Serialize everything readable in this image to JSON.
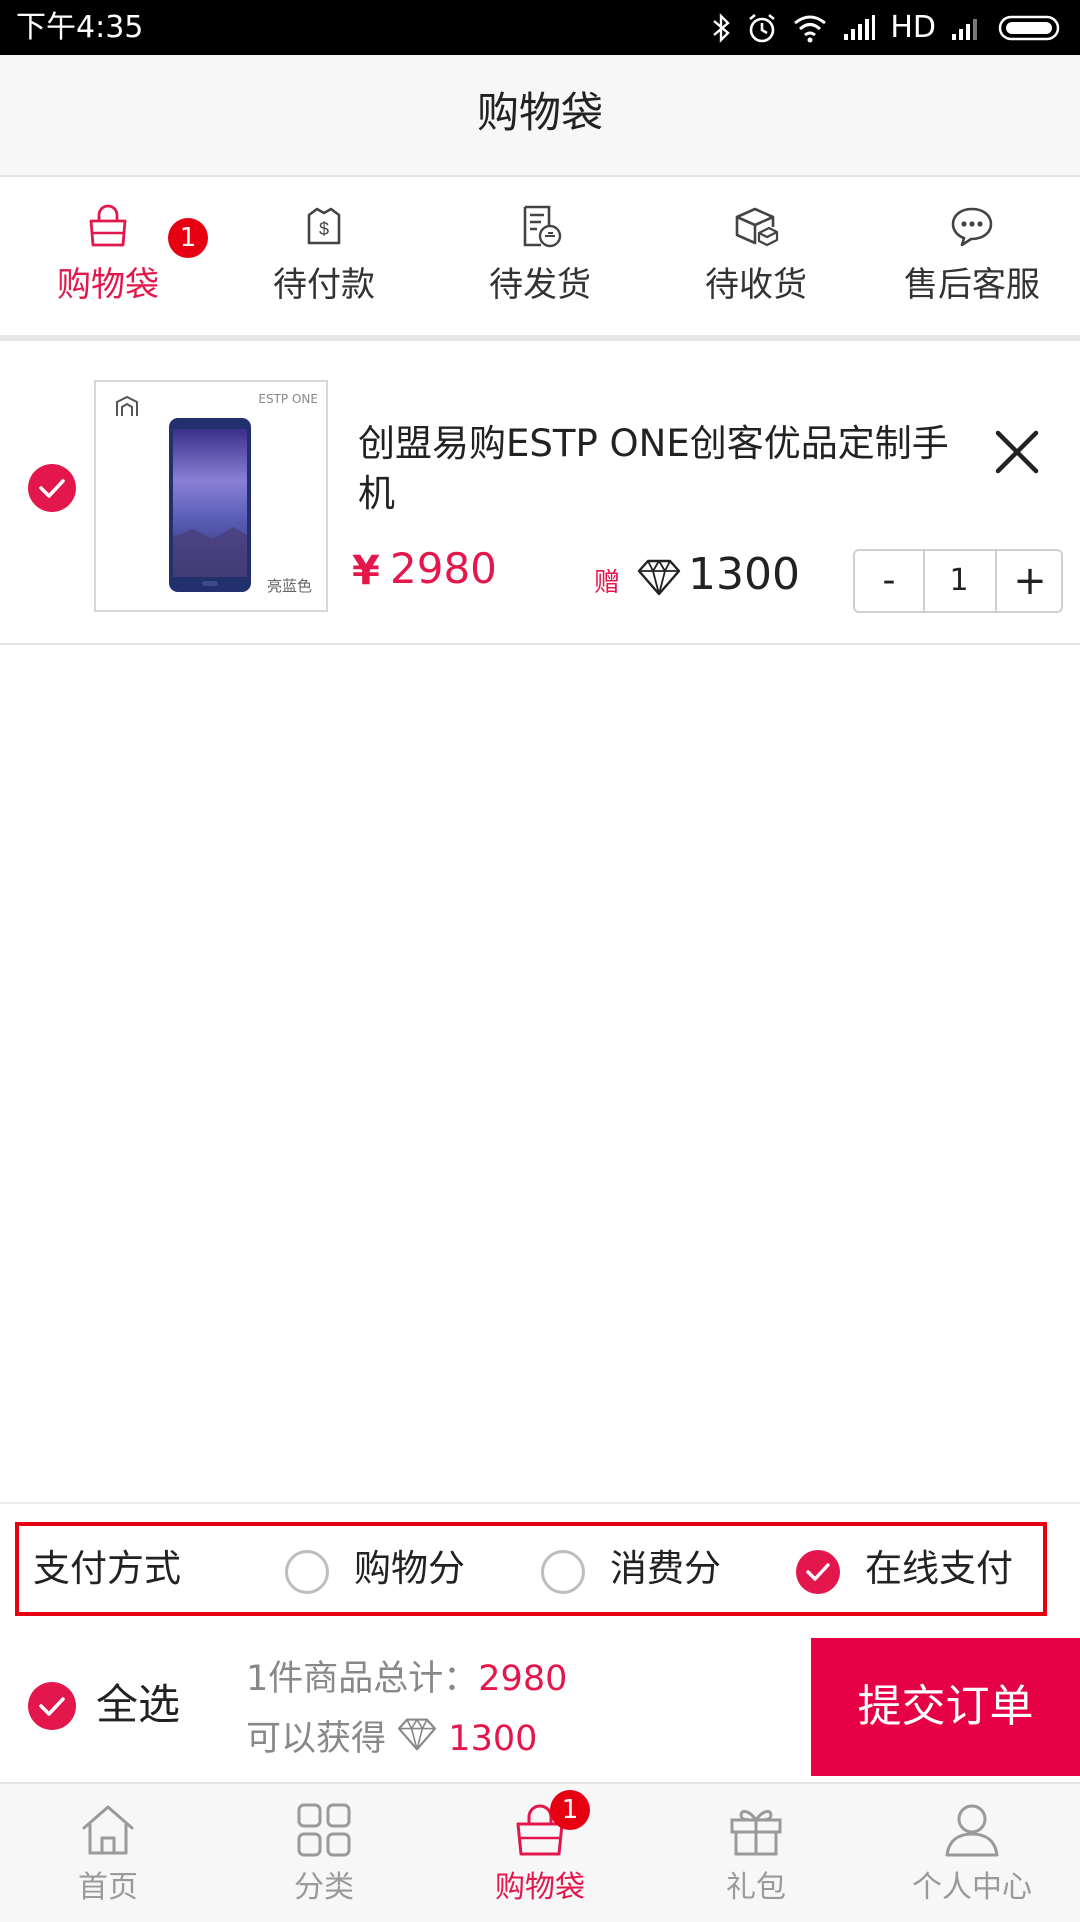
{
  "status_bar": {
    "time": "下午4:35",
    "network": "HD"
  },
  "header": {
    "title": "购物袋"
  },
  "order_tabs": [
    {
      "label": "购物袋",
      "icon": "shopping-bag-icon",
      "active": true,
      "badge": "1"
    },
    {
      "label": "待付款",
      "icon": "payment-pending-icon",
      "active": false
    },
    {
      "label": "待发货",
      "icon": "to-ship-icon",
      "active": false
    },
    {
      "label": "待收货",
      "icon": "to-receive-icon",
      "active": false
    },
    {
      "label": "售后客服",
      "icon": "customer-service-icon",
      "active": false
    }
  ],
  "cart_item": {
    "checked": true,
    "title": "创盟易购ESTP ONE创客优品定制手机",
    "thumb_brand": "ESTP ONE",
    "thumb_color": "亮蓝色",
    "currency": "¥",
    "price": "2980",
    "gift_label": "赠",
    "gift_points": "1300",
    "quantity": "1",
    "minus": "-",
    "plus": "+"
  },
  "payment": {
    "label": "支付方式",
    "options": [
      {
        "label": "购物分",
        "checked": false
      },
      {
        "label": "消费分",
        "checked": false
      },
      {
        "label": "在线支付",
        "checked": true
      }
    ]
  },
  "checkout": {
    "select_all_label": "全选",
    "summary_prefix": "1件商品总计：",
    "total": "2980",
    "earn_prefix": "可以获得",
    "earn_points": "1300",
    "submit_label": "提交订单"
  },
  "bottom_nav": [
    {
      "label": "首页",
      "icon": "home-icon",
      "active": false
    },
    {
      "label": "分类",
      "icon": "category-grid-icon",
      "active": false
    },
    {
      "label": "购物袋",
      "icon": "shopping-bag-icon",
      "active": true,
      "badge": "1"
    },
    {
      "label": "礼包",
      "icon": "gift-icon",
      "active": false
    },
    {
      "label": "个人中心",
      "icon": "user-icon",
      "active": false
    }
  ],
  "colors": {
    "accent": "#e4174c",
    "badge": "#e60012",
    "submit_bg": "#e60045"
  }
}
